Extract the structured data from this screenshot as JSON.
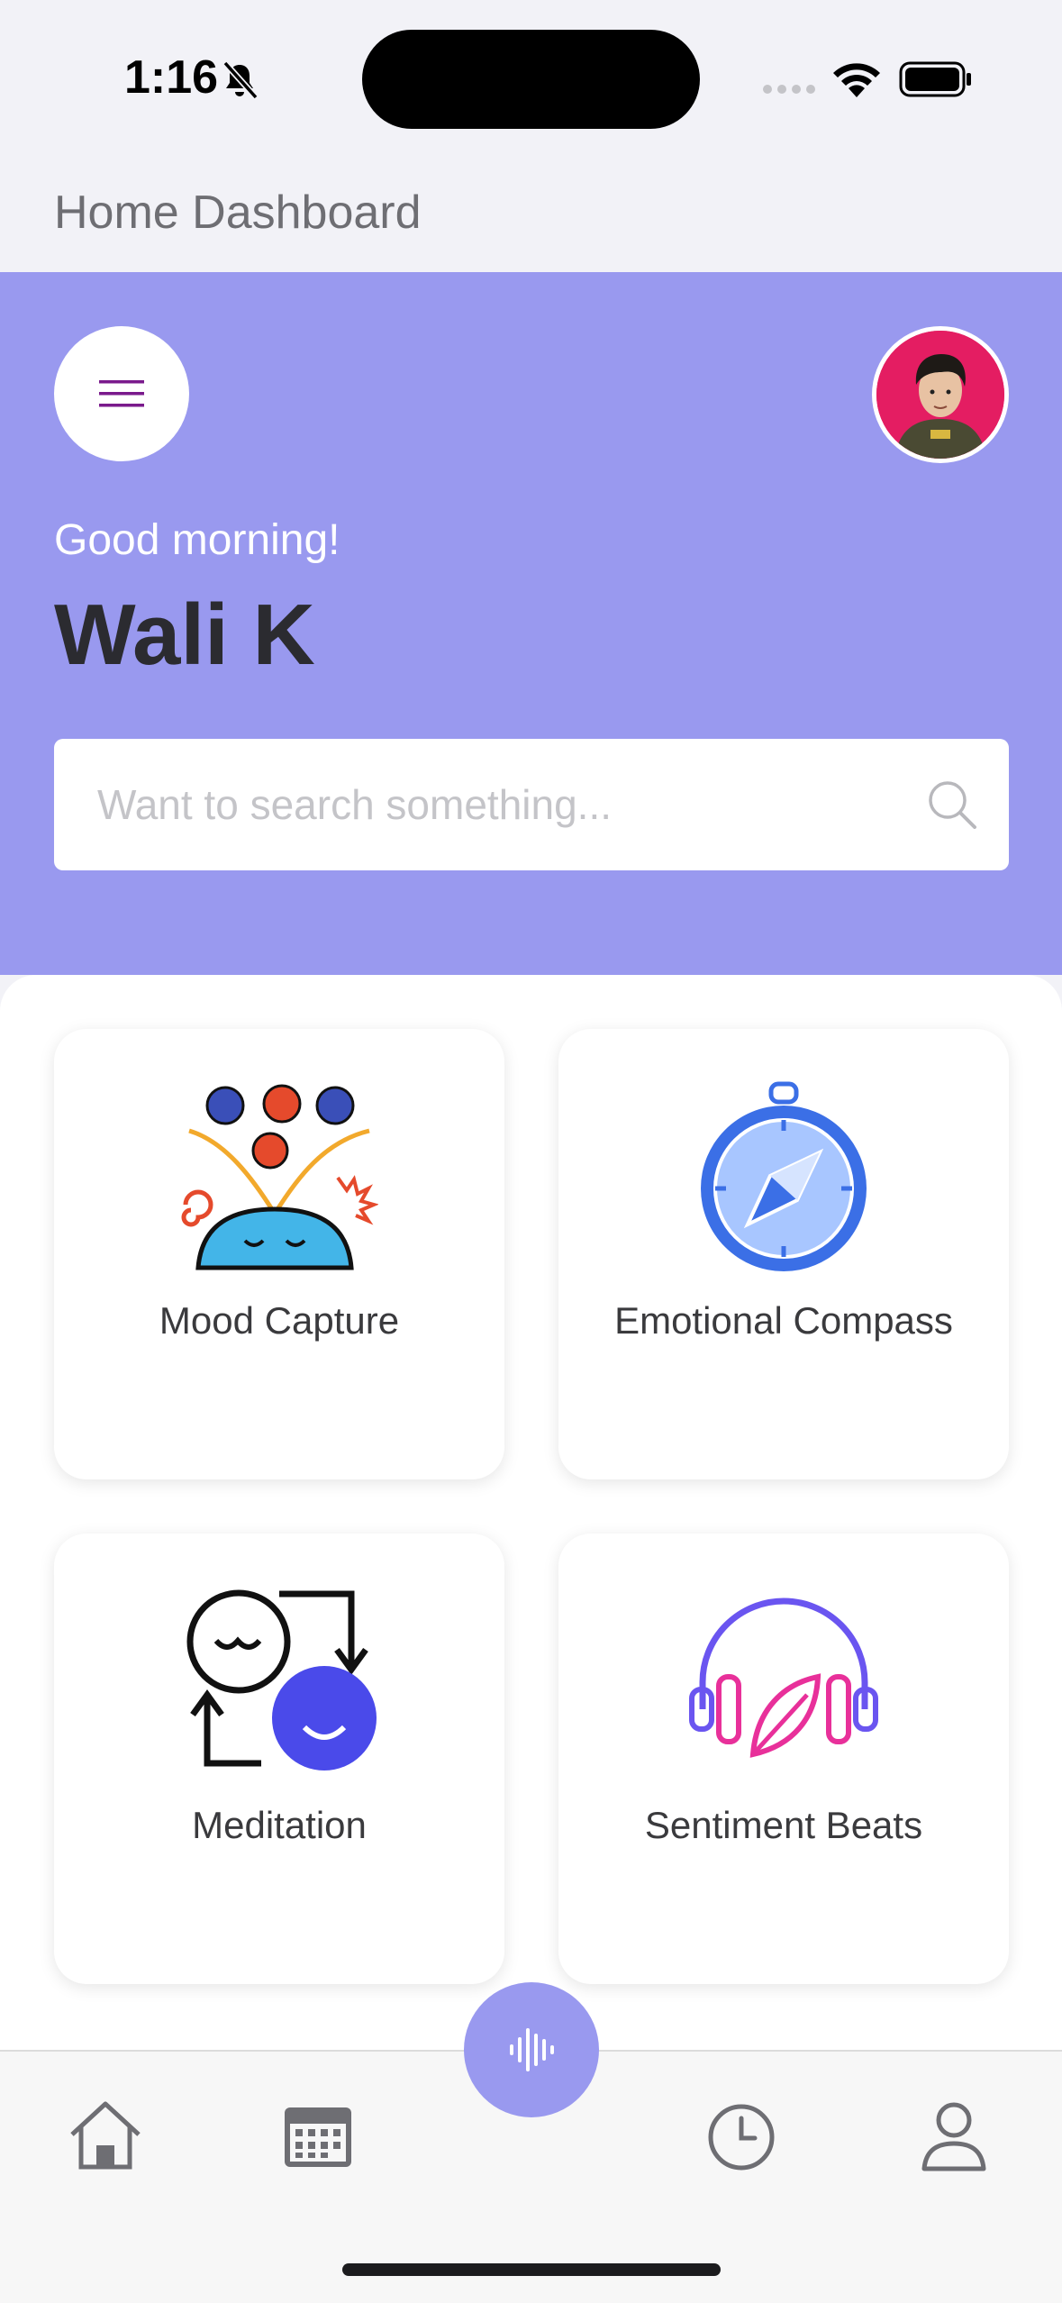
{
  "status_bar": {
    "time": "1:16",
    "icons": [
      "bell-slash-icon",
      "cellular-signal-icon",
      "wifi-icon",
      "battery-icon"
    ]
  },
  "header": {
    "title": "Home Dashboard"
  },
  "hero": {
    "background_color": "#9999ef",
    "greeting": "Good morning!",
    "user_name": "Wali K",
    "menu_icon": "hamburger-menu-icon",
    "avatar_alt": "user avatar"
  },
  "search": {
    "placeholder": "Want to search something...",
    "icon": "search-icon"
  },
  "cards": [
    {
      "label": "Mood Capture",
      "icon": "mood-faces-icon"
    },
    {
      "label": "Emotional Compass",
      "icon": "compass-icon"
    },
    {
      "label": "Meditation",
      "icon": "meditation-cycle-icon"
    },
    {
      "label": "Sentiment Beats",
      "icon": "headphones-leaf-icon"
    }
  ],
  "tab_bar": {
    "tabs": [
      {
        "icon": "home-icon"
      },
      {
        "icon": "calendar-icon"
      },
      {
        "icon": "clock-icon"
      },
      {
        "icon": "profile-icon"
      }
    ],
    "center_button_icon": "voice-waveform-icon",
    "accent_color": "#9999ef"
  }
}
